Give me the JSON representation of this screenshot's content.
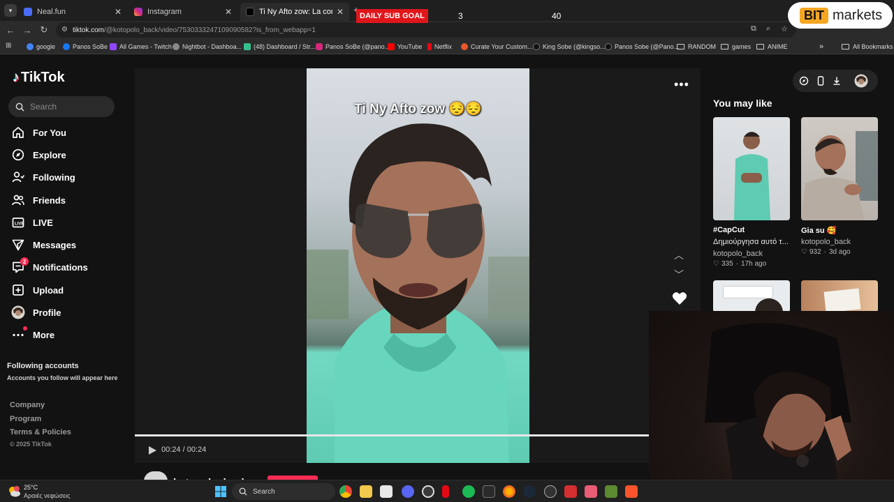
{
  "browser": {
    "tabs": [
      {
        "title": "Neal.fun",
        "color": "#4a6cf7"
      },
      {
        "title": "Instagram",
        "color": "#d6297a"
      },
      {
        "title": "Ti Ny Afto zow: La comédie au",
        "color": "#111111"
      }
    ],
    "new_tab_label": "+",
    "url_host": "tiktok.com",
    "url_path": "/@kotopolo_back/video/7530333247109090582?is_from_webapp=1",
    "bookmarks": [
      {
        "label": "google",
        "color": "#4285f4"
      },
      {
        "label": "Panos SoBe",
        "color": "#1877f2"
      },
      {
        "label": "All Games - Twitch",
        "color": "#9146ff"
      },
      {
        "label": "Nightbot - Dashboa...",
        "color": "#888888"
      },
      {
        "label": "(48) Dashboard / Str...",
        "color": "#35c08c"
      },
      {
        "label": "Panos SoBe (@pano...",
        "color": "#d6297a"
      },
      {
        "label": "YouTube",
        "color": "#ff0000"
      },
      {
        "label": "Netflix",
        "color": "#e50914"
      },
      {
        "label": "Curate Your Custom...",
        "color": "#e8572a"
      },
      {
        "label": "King Sobe (@kingso...",
        "color": "#111111"
      },
      {
        "label": "Panos Sobe (@Pano...",
        "color": "#111111"
      }
    ],
    "folders": [
      "RANDOM",
      "games",
      "ANIME"
    ],
    "overflow_label": "»",
    "all_bookmarks": "All Bookmarks"
  },
  "overlay": {
    "sub_goal_label": "DAILY SUB GOAL",
    "sub_current": "3",
    "sub_target": "40",
    "sponsor_bit": "BIT",
    "sponsor_markets": "markets"
  },
  "tiktok": {
    "logo": "TikTok",
    "search_placeholder": "Search",
    "nav": [
      {
        "label": "For You",
        "icon": "home-icon"
      },
      {
        "label": "Explore",
        "icon": "compass-icon"
      },
      {
        "label": "Following",
        "icon": "following-icon"
      },
      {
        "label": "Friends",
        "icon": "friends-icon"
      },
      {
        "label": "LIVE",
        "icon": "live-icon"
      },
      {
        "label": "Messages",
        "icon": "messages-icon"
      },
      {
        "label": "Notifications",
        "icon": "notifications-icon",
        "badge": "2"
      },
      {
        "label": "Upload",
        "icon": "upload-icon"
      },
      {
        "label": "Profile",
        "icon": "profile-avatar"
      },
      {
        "label": "More",
        "icon": "more-icon"
      }
    ],
    "following_accounts_title": "Following accounts",
    "following_accounts_sub": "Accounts you follow will appear here",
    "footer_links": [
      "Company",
      "Program",
      "Terms & Policies"
    ],
    "copyright": "© 2025 TikTok",
    "video": {
      "caption": "Ti Ny Afto zow 😔😔",
      "time": "00:24 / 00:24",
      "progress": 1.0,
      "author": "kotopolo_back"
    },
    "you_may_like": "You may like",
    "recommendations": [
      {
        "title": "#CapCut",
        "desc": "Δημιούργησα αυτό τ...",
        "author": "kotopolo_back",
        "likes": "335",
        "age": "17h ago"
      },
      {
        "title": "Gia su 🥰",
        "desc": "",
        "author": "kotopolo_back",
        "likes": "932",
        "age": "3d ago"
      }
    ]
  },
  "taskbar": {
    "temp": "25°C",
    "weather": "Αραιές νεφώσεις",
    "search": "Search"
  }
}
